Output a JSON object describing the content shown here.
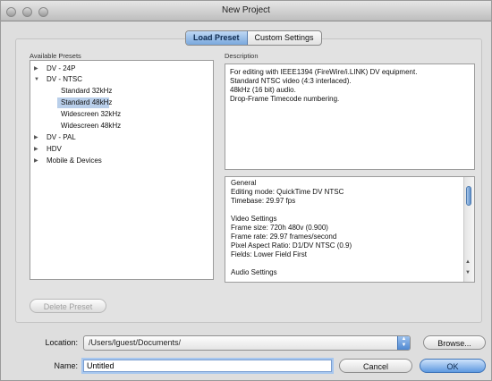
{
  "window": {
    "title": "New Project"
  },
  "tabs": [
    {
      "label": "Load Preset"
    },
    {
      "label": "Custom Settings"
    }
  ],
  "presets": {
    "label": "Available Presets",
    "items": [
      {
        "label": "DV - 24P"
      },
      {
        "label": "DV - NTSC"
      },
      {
        "label": "Standard 32kHz"
      },
      {
        "label": "Standard 48kHz"
      },
      {
        "label": "Widescreen 32kHz"
      },
      {
        "label": "Widescreen 48kHz"
      },
      {
        "label": "DV - PAL"
      },
      {
        "label": "HDV"
      },
      {
        "label": "Mobile & Devices"
      }
    ]
  },
  "description": {
    "label": "Description",
    "text": "For editing with IEEE1394 (FireWire/i.LINK) DV equipment.\nStandard NTSC video (4:3 interlaced).\n48kHz (16 bit) audio.\nDrop-Frame Timecode numbering."
  },
  "info": {
    "lines": [
      "General",
      " Editing mode: QuickTime DV NTSC",
      " Timebase: 29.97 fps",
      "",
      "Video Settings",
      " Frame size: 720h 480v (0.900)",
      " Frame rate: 29.97 frames/second",
      " Pixel Aspect Ratio: D1/DV NTSC (0.9)",
      " Fields: Lower Field First",
      "",
      "Audio Settings"
    ]
  },
  "buttons": {
    "delete_preset": "Delete Preset",
    "browse": "Browse...",
    "cancel": "Cancel",
    "ok": "OK"
  },
  "location": {
    "label": "Location:",
    "value": "/Users/lguest/Documents/"
  },
  "name": {
    "label": "Name:",
    "value": "Untitled"
  }
}
